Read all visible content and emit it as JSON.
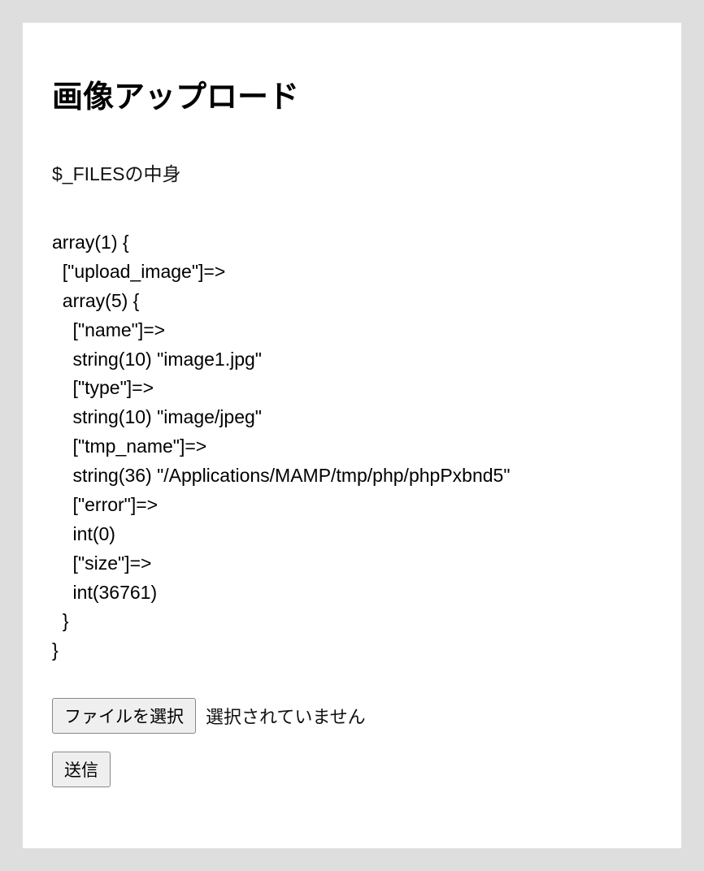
{
  "title": "画像アップロード",
  "subtitle": "$_FILESの中身",
  "dump": "array(1) {\n  [\"upload_image\"]=>\n  array(5) {\n    [\"name\"]=>\n    string(10) \"image1.jpg\"\n    [\"type\"]=>\n    string(10) \"image/jpeg\"\n    [\"tmp_name\"]=>\n    string(36) \"/Applications/MAMP/tmp/php/phpPxbnd5\"\n    [\"error\"]=>\n    int(0)\n    [\"size\"]=>\n    int(36761)\n  }\n}",
  "file_input": {
    "button_label": "ファイルを選択",
    "status_text": "選択されていません"
  },
  "submit_label": "送信"
}
